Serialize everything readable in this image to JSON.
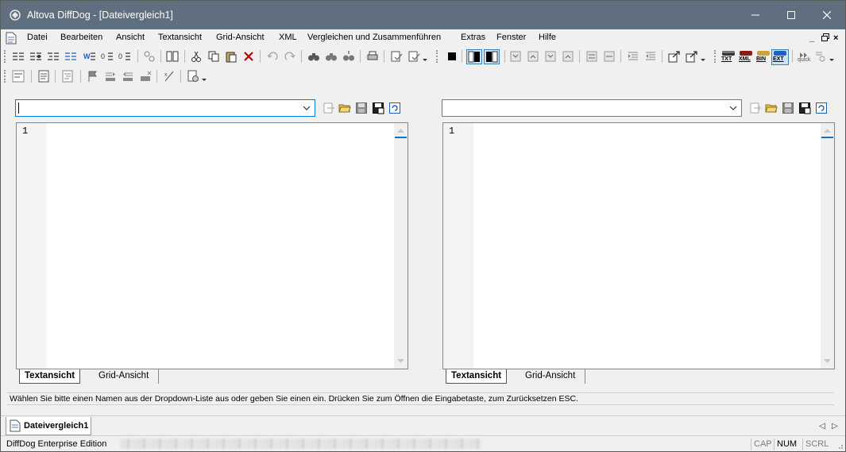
{
  "window": {
    "title": "Altova DiffDog - [Dateivergleich1]",
    "controls": {
      "minimize": "—",
      "maximize": "☐",
      "close": "✕"
    }
  },
  "menu": {
    "items": [
      "Datei",
      "Bearbeiten",
      "Ansicht",
      "Textansicht",
      "Grid-Ansicht",
      "XML",
      "Vergleichen und Zusammenführen",
      "Extras",
      "Fenster",
      "Hilfe"
    ],
    "mdi_controls": [
      "_",
      "ř",
      "×"
    ]
  },
  "left_pane": {
    "path_value": "",
    "line_numbers": [
      "1"
    ],
    "view_tabs": [
      "Textansicht",
      "Grid-Ansicht"
    ],
    "active_view": "Textansicht"
  },
  "right_pane": {
    "path_value": "",
    "line_numbers": [
      "1"
    ],
    "view_tabs": [
      "Textansicht",
      "Grid-Ansicht"
    ],
    "active_view": "Textansicht"
  },
  "hint": "Wählen Sie bitte einen Namen aus der Dropdown-Liste aus oder geben Sie einen ein. Drücken Sie zum Öffnen die Eingabetaste, zum Zurücksetzen ESC.",
  "doc_tabs": [
    "Dateivergleich1"
  ],
  "status": {
    "edition": "DiffDog Enterprise Edition",
    "indicators": [
      {
        "label": "CAP",
        "active": false
      },
      {
        "label": "NUM",
        "active": true
      },
      {
        "label": "SCRL",
        "active": false
      }
    ]
  },
  "colors": {
    "titlebar": "#5f6f7f",
    "focus_accent": "#0078d7",
    "chrome": "#f0f0f0"
  },
  "toolbar_labels": {
    "txt": "TXT",
    "xml": "XML",
    "bin": "BIN",
    "ext": "EXT",
    "quick": "quick"
  }
}
